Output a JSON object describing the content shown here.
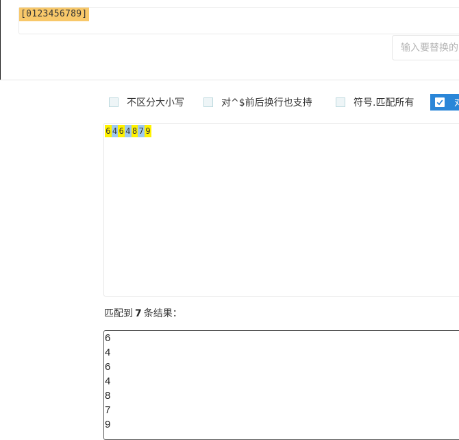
{
  "regex": {
    "pattern": "[0123456789]",
    "highlight_color": "#f8c86a"
  },
  "replace": {
    "placeholder": "输入要替换的内容"
  },
  "options": [
    {
      "label": "不区分大小写",
      "checked": false
    },
    {
      "label": "对^$前后换行也支持",
      "checked": false
    },
    {
      "label": "符号.匹配所有",
      "checked": false
    },
    {
      "label": "对",
      "checked": true
    }
  ],
  "test_text": {
    "chars": [
      "6",
      "4",
      "6",
      "4",
      "8",
      "7",
      "9"
    ],
    "match_colors": [
      "#fff200",
      "#9fc9f0"
    ]
  },
  "summary": {
    "prefix": "匹配到",
    "count": "7",
    "suffix": "条结果："
  },
  "results": [
    "6",
    "4",
    "6",
    "4",
    "8",
    "7",
    "9"
  ],
  "colors": {
    "accent": "#2a86d8",
    "border": "#e6e6e6"
  }
}
